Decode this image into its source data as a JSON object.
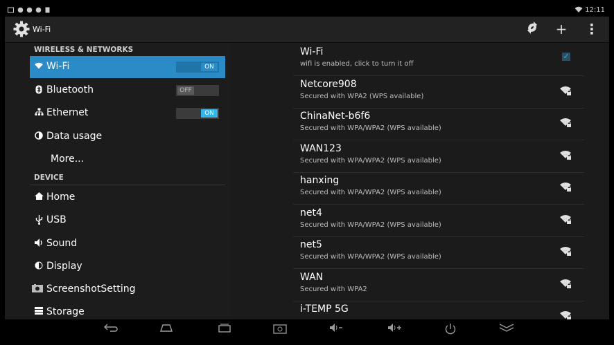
{
  "status_bar": {
    "time": "12:11",
    "wifi_icon": "wifi-signal-icon"
  },
  "action_bar": {
    "title": "Wi-Fi",
    "icons": [
      "settings-gear-icon",
      "wps-icon",
      "add-icon",
      "overflow-menu-icon"
    ],
    "add_label": "+",
    "menu_label": "⋮"
  },
  "sidebar": {
    "section_wireless": "WIRELESS & NETWORKS",
    "section_device": "DEVICE",
    "items": [
      {
        "label": "Wi-Fi",
        "icon": "wifi-icon",
        "toggle": "ON",
        "selected": true
      },
      {
        "label": "Bluetooth",
        "icon": "bluetooth-icon",
        "toggle": "OFF"
      },
      {
        "label": "Ethernet",
        "icon": "ethernet-icon",
        "toggle": "ON"
      },
      {
        "label": "Data usage",
        "icon": "data-usage-icon"
      },
      {
        "label": "More..."
      },
      {
        "label": "Home",
        "icon": "home-icon"
      },
      {
        "label": "USB",
        "icon": "usb-icon"
      },
      {
        "label": "Sound",
        "icon": "sound-icon"
      },
      {
        "label": "Display",
        "icon": "display-icon"
      },
      {
        "label": "ScreenshotSetting",
        "icon": "screenshot-icon"
      },
      {
        "label": "Storage",
        "icon": "storage-icon"
      }
    ]
  },
  "wifi_panel": {
    "title": "Wi-Fi",
    "subtitle": "wifi is enabled, click to turn it off",
    "enabled_checkbox": true,
    "networks": [
      {
        "name": "Netcore908",
        "security": "Secured with WPA2 (WPS available)"
      },
      {
        "name": "ChinaNet-b6f6",
        "security": "Secured with WPA/WPA2 (WPS available)"
      },
      {
        "name": "WAN123",
        "security": "Secured with WPA/WPA2 (WPS available)"
      },
      {
        "name": "hanxing",
        "security": "Secured with WPA/WPA2 (WPS available)"
      },
      {
        "name": "net4",
        "security": "Secured with WPA/WPA2 (WPS available)"
      },
      {
        "name": "net5",
        "security": "Secured with WPA/WPA2 (WPS available)"
      },
      {
        "name": "WAN",
        "security": "Secured with WPA2"
      },
      {
        "name": "i-TEMP 5G",
        "security": ""
      }
    ]
  },
  "nav_bar": {
    "buttons": [
      "back-icon",
      "home-icon",
      "recents-icon",
      "screenshot-icon",
      "volume-down-icon",
      "volume-up-icon",
      "power-icon",
      "hide-bar-icon"
    ]
  },
  "colors": {
    "accent": "#33b5e5",
    "selected_bg": "#2a8bc7",
    "background": "#1b1b1b"
  }
}
